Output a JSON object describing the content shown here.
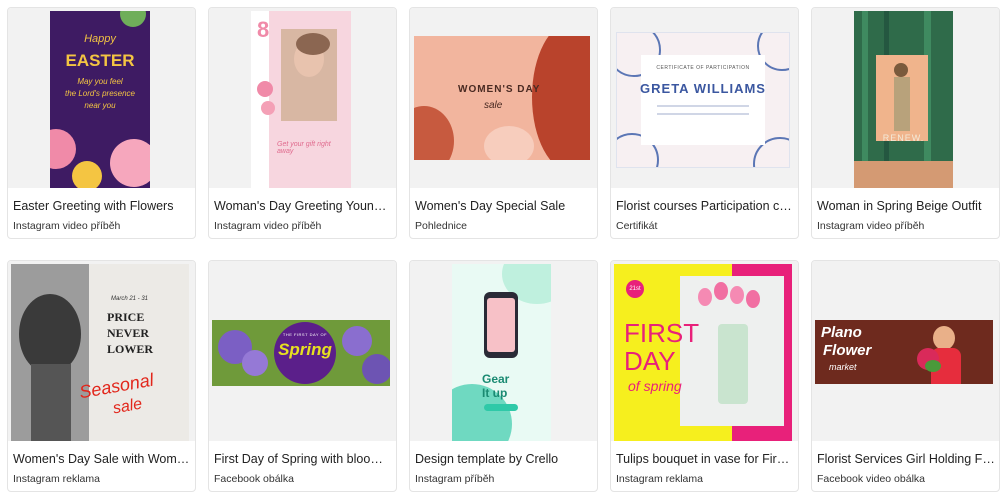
{
  "templates": [
    {
      "title": "Easter Greeting with Flowers",
      "type": "Instagram video příběh",
      "art": {
        "lines": [
          "Happy",
          "EASTER",
          "May you feel",
          "the Lord's presence",
          "near you"
        ]
      }
    },
    {
      "title": "Woman's Day Greeting Young Woman...",
      "type": "Instagram video příběh",
      "art": {
        "big": "8",
        "small": "Get your gift right away"
      }
    },
    {
      "title": "Women's Day Special Sale",
      "type": "Pohlednice",
      "art": {
        "headline": "WOMEN'S DAY",
        "sub": "sale"
      }
    },
    {
      "title": "Florist courses Participation certificate",
      "type": "Certifikát",
      "art": {
        "caption": "CERTIFICATE OF PARTICIPATION",
        "name": "GRETA WILLIAMS"
      }
    },
    {
      "title": "Woman in Spring Beige Outfit",
      "type": "Instagram video příběh",
      "art": {
        "word": "RENEW."
      }
    },
    {
      "title": "Women's Day Sale with Woman in Earrings",
      "type": "Instagram reklama",
      "art": {
        "date": "March 21 - 31",
        "lines": [
          "PRICE",
          "NEVER",
          "LOWER"
        ],
        "script": [
          "Seasonal",
          "sale"
        ]
      }
    },
    {
      "title": "First Day of Spring with blooming flowers",
      "type": "Facebook obálka",
      "art": {
        "top": "THE FIRST DAY OF",
        "word": "Spring"
      }
    },
    {
      "title": "Design template by Crello",
      "type": "Instagram příběh",
      "art": {
        "lines": [
          "Gear",
          "It up"
        ]
      }
    },
    {
      "title": "Tulips bouquet in vase for First Day of Spring",
      "type": "Instagram reklama",
      "art": {
        "badge": "21st",
        "lines": [
          "FIRST",
          "DAY"
        ],
        "script": "of spring"
      }
    },
    {
      "title": "Florist Services Girl Holding Flowers",
      "type": "Facebook video obálka",
      "art": {
        "lines": [
          "Plano",
          "Flower",
          "market"
        ]
      }
    }
  ],
  "colors": {
    "title": "#222222",
    "subtitle": "#333333",
    "card_border": "#e4e4e4",
    "thumb_bg": "#f2f2f2"
  }
}
